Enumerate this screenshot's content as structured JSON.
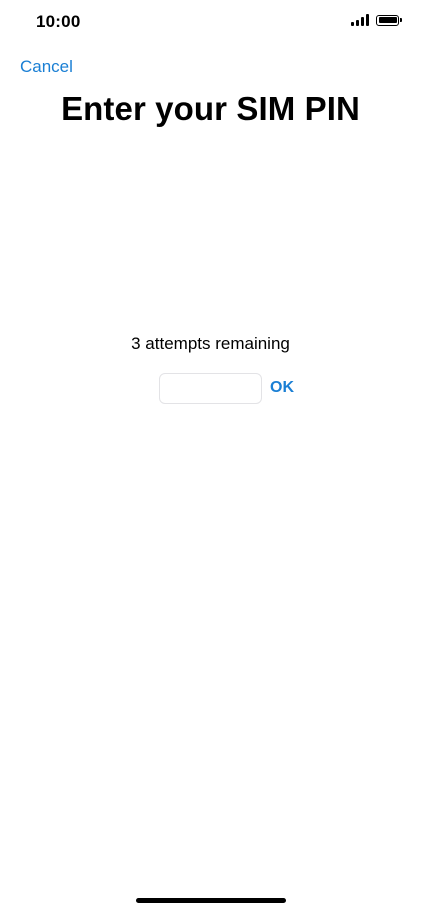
{
  "status_bar": {
    "time": "10:00",
    "signal_icon": "cellular-signal-icon",
    "battery_icon": "battery-full-icon",
    "battery_level": 1.0
  },
  "navigation": {
    "cancel_label": "Cancel"
  },
  "page": {
    "title": "Enter your SIM PIN"
  },
  "pin_entry": {
    "attempts_text": "3 attempts remaining",
    "input_value": "",
    "ok_label": "OK"
  },
  "colors": {
    "accent": "#1a7fd4",
    "background": "#ffffff",
    "text": "#000000"
  }
}
